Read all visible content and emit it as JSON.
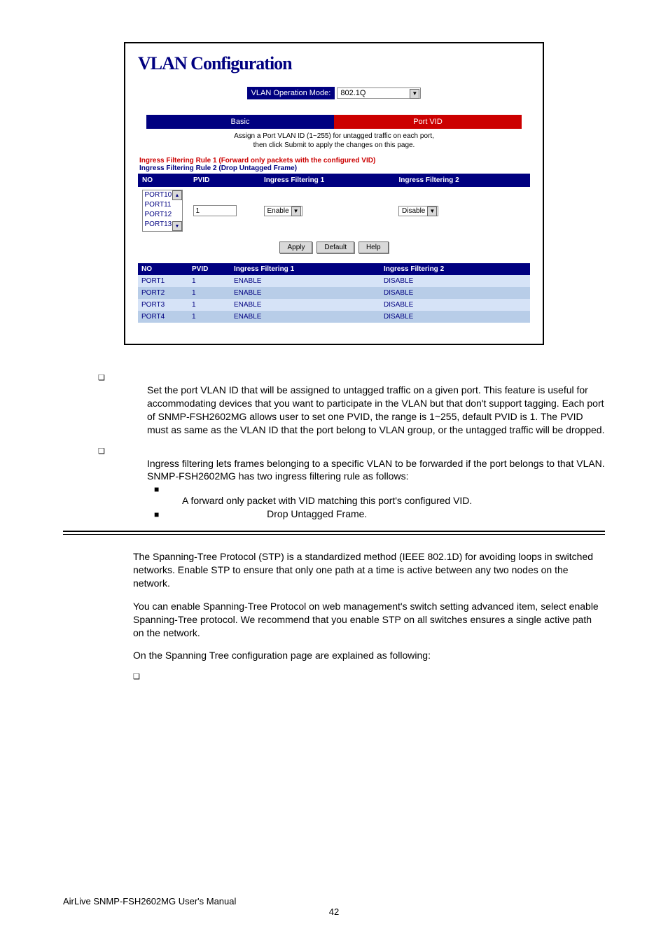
{
  "screenshot": {
    "title": "VLAN Configuration",
    "opModeLabel": "VLAN Operation Mode:",
    "opModeValue": "802.1Q",
    "tabBasic": "Basic",
    "tabPortVid": "Port VID",
    "desc1": "Assign a Port VLAN ID (1~255) for untagged traffic on each port,",
    "desc2": "then click Submit to apply the changes on this page.",
    "rule1": "Ingress Filtering Rule 1 (Forward only packets with the configured VID)",
    "rule2": "Ingress Filtering Rule 2 (Drop Untagged Frame)",
    "headers": {
      "no": "NO",
      "pvid": "PVID",
      "if1": "Ingress Filtering 1",
      "if2": "Ingress Filtering 2"
    },
    "portList": [
      "PORT10",
      "PORT11",
      "PORT12",
      "PORT13"
    ],
    "pvidInput": "1",
    "if1Select": "Enable",
    "if2Select": "Disable",
    "buttons": {
      "apply": "Apply",
      "default": "Default",
      "help": "Help"
    },
    "statusRows": [
      {
        "no": "PORT1",
        "pvid": "1",
        "if1": "ENABLE",
        "if2": "DISABLE"
      },
      {
        "no": "PORT2",
        "pvid": "1",
        "if1": "ENABLE",
        "if2": "DISABLE"
      },
      {
        "no": "PORT3",
        "pvid": "1",
        "if1": "ENABLE",
        "if2": "DISABLE"
      },
      {
        "no": "PORT4",
        "pvid": "1",
        "if1": "ENABLE",
        "if2": "DISABLE"
      }
    ]
  },
  "body": {
    "pvidPara": "Set the port VLAN ID that will be assigned to untagged traffic on a given port. This feature is useful for accommodating devices that you want to participate in the VLAN but that don't support tagging. Each port of SNMP-FSH2602MG allows user to set one PVID, the range is 1~255, default PVID is 1. The PVID must as same as the VLAN ID that the port belong to VLAN group, or the untagged traffic will be dropped.",
    "ingressPara": "Ingress filtering lets frames belonging to a specific VLAN to be forwarded if the port belongs to that VLAN. SNMP-FSH2602MG has two ingress filtering rule as follows:",
    "ingressSub1": "A forward only packet with VID matching this port's configured VID.",
    "ingressSub2": "Drop Untagged Frame.",
    "stpPara1": "The Spanning-Tree Protocol (STP) is a standardized method (IEEE 802.1D) for avoiding loops in switched networks.  Enable STP to ensure that only one path at a time is active between any two nodes on the network.",
    "stpPara2": "You can enable Spanning-Tree Protocol on web management's switch setting advanced item, select enable Spanning-Tree protocol.  We recommend that you enable STP on all switches ensures a single active path on the network.",
    "stpPara3": "On the Spanning Tree configuration page are explained as following:"
  },
  "footer": {
    "manual": "AirLive SNMP-FSH2602MG User's Manual",
    "page": "42"
  }
}
